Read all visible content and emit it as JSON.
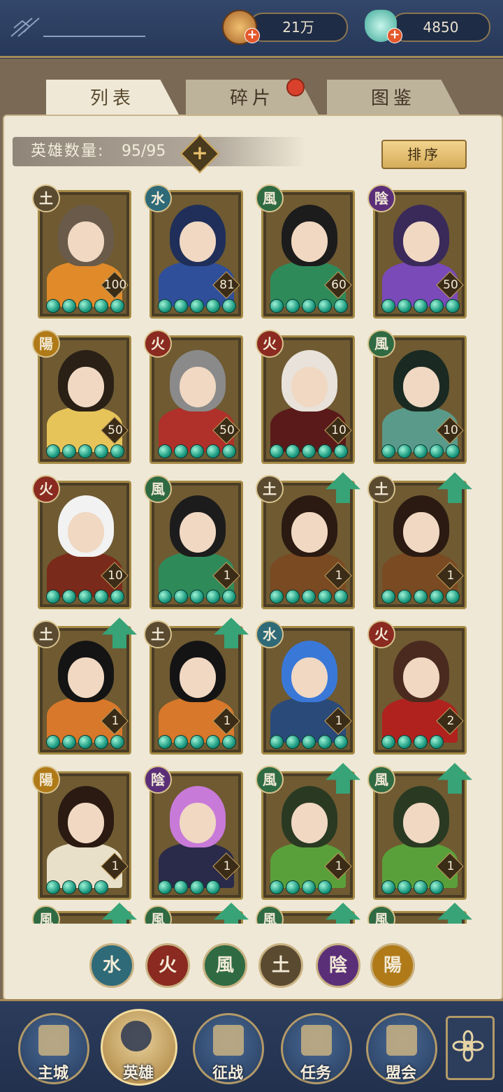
{
  "resources": [
    {
      "name": "coin",
      "value": "21万",
      "color": "#c98a3a"
    },
    {
      "name": "jade",
      "value": "4850",
      "color": "#5cc3b0"
    }
  ],
  "tabs": [
    {
      "label": "列表",
      "active": true
    },
    {
      "label": "碎片",
      "active": false,
      "has_notification": true
    },
    {
      "label": "图鉴",
      "active": false
    }
  ],
  "hero_count": {
    "label": "英雄数量:",
    "value": "95/95"
  },
  "sort_label": "排序",
  "elements": {
    "water": {
      "glyph": "水",
      "color": "#2e6a78"
    },
    "fire": {
      "glyph": "火",
      "color": "#8a2a20"
    },
    "wind": {
      "glyph": "風",
      "color": "#2f6a42"
    },
    "earth": {
      "glyph": "土",
      "color": "#5a4a30"
    },
    "yin": {
      "glyph": "陰",
      "color": "#5a2f78"
    },
    "yang": {
      "glyph": "陽",
      "color": "#b07a18"
    }
  },
  "heroes": [
    {
      "element": "earth",
      "level": "100",
      "gems": 5,
      "upgrade": false,
      "hair": "#6a5a4a",
      "outfit": "#e08a2a"
    },
    {
      "element": "water",
      "level": "81",
      "gems": 5,
      "upgrade": false,
      "hair": "#1f2f5a",
      "outfit": "#2f4f9a"
    },
    {
      "element": "wind",
      "level": "60",
      "gems": 5,
      "upgrade": false,
      "hair": "#1c1c1c",
      "outfit": "#2f8a5a"
    },
    {
      "element": "yin",
      "level": "50",
      "gems": 5,
      "upgrade": false,
      "hair": "#3a2a5a",
      "outfit": "#7a4ab8"
    },
    {
      "element": "yang",
      "level": "50",
      "gems": 5,
      "upgrade": false,
      "hair": "#2a2016",
      "outfit": "#e6c45a"
    },
    {
      "element": "fire",
      "level": "50",
      "gems": 5,
      "upgrade": false,
      "hair": "#8a8a8a",
      "outfit": "#b0302a"
    },
    {
      "element": "fire",
      "level": "10",
      "gems": 5,
      "upgrade": false,
      "hair": "#e8e2da",
      "outfit": "#5a1a1a"
    },
    {
      "element": "wind",
      "level": "10",
      "gems": 5,
      "upgrade": false,
      "hair": "#1a2a22",
      "outfit": "#5a9a8a"
    },
    {
      "element": "fire",
      "level": "10",
      "gems": 5,
      "upgrade": false,
      "hair": "#f2f2f2",
      "outfit": "#7a2a1a"
    },
    {
      "element": "wind",
      "level": "1",
      "gems": 5,
      "upgrade": false,
      "hair": "#1c1c1c",
      "outfit": "#2f8a5a"
    },
    {
      "element": "earth",
      "level": "1",
      "gems": 5,
      "upgrade": true,
      "hair": "#2a1a12",
      "outfit": "#7a4a22"
    },
    {
      "element": "earth",
      "level": "1",
      "gems": 5,
      "upgrade": true,
      "hair": "#2a1a12",
      "outfit": "#7a4a22"
    },
    {
      "element": "earth",
      "level": "1",
      "gems": 5,
      "upgrade": true,
      "hair": "#141414",
      "outfit": "#d8782a"
    },
    {
      "element": "earth",
      "level": "1",
      "gems": 5,
      "upgrade": true,
      "hair": "#141414",
      "outfit": "#d8782a"
    },
    {
      "element": "water",
      "level": "1",
      "gems": 5,
      "upgrade": false,
      "hair": "#3a78d8",
      "outfit": "#2a4a7a"
    },
    {
      "element": "fire",
      "level": "2",
      "gems": 4,
      "upgrade": false,
      "hair": "#4a2a1e",
      "outfit": "#b0221e"
    },
    {
      "element": "yang",
      "level": "1",
      "gems": 4,
      "upgrade": false,
      "hair": "#2a1a12",
      "outfit": "#e8e0c8"
    },
    {
      "element": "yin",
      "level": "1",
      "gems": 4,
      "upgrade": false,
      "hair": "#c87ad8",
      "outfit": "#2a2a4a"
    },
    {
      "element": "wind",
      "level": "1",
      "gems": 4,
      "upgrade": true,
      "hair": "#2a3a22",
      "outfit": "#5aa03a"
    },
    {
      "element": "wind",
      "level": "1",
      "gems": 4,
      "upgrade": true,
      "hair": "#2a3a22",
      "outfit": "#5aa03a"
    },
    {
      "element": "wind",
      "level": "",
      "gems": 0,
      "upgrade": true,
      "hair": "#2a3a22",
      "outfit": "#5aa03a"
    },
    {
      "element": "wind",
      "level": "",
      "gems": 0,
      "upgrade": true,
      "hair": "#2a3a22",
      "outfit": "#5aa03a"
    },
    {
      "element": "wind",
      "level": "",
      "gems": 0,
      "upgrade": true,
      "hair": "#2a3a22",
      "outfit": "#5aa03a"
    },
    {
      "element": "wind",
      "level": "",
      "gems": 0,
      "upgrade": true,
      "hair": "#2a3a22",
      "outfit": "#5aa03a"
    }
  ],
  "filters": [
    "water",
    "fire",
    "wind",
    "earth",
    "yin",
    "yang"
  ],
  "nav": [
    {
      "label": "主城",
      "icon": "palace-icon",
      "active": false
    },
    {
      "label": "英雄",
      "icon": "hero-avatar-icon",
      "active": true
    },
    {
      "label": "征战",
      "icon": "scroll-icon",
      "active": false
    },
    {
      "label": "任务",
      "icon": "bell-icon",
      "active": false
    },
    {
      "label": "盟会",
      "icon": "pavilion-icon",
      "active": false
    }
  ],
  "more_icon": "flower-menu-icon"
}
